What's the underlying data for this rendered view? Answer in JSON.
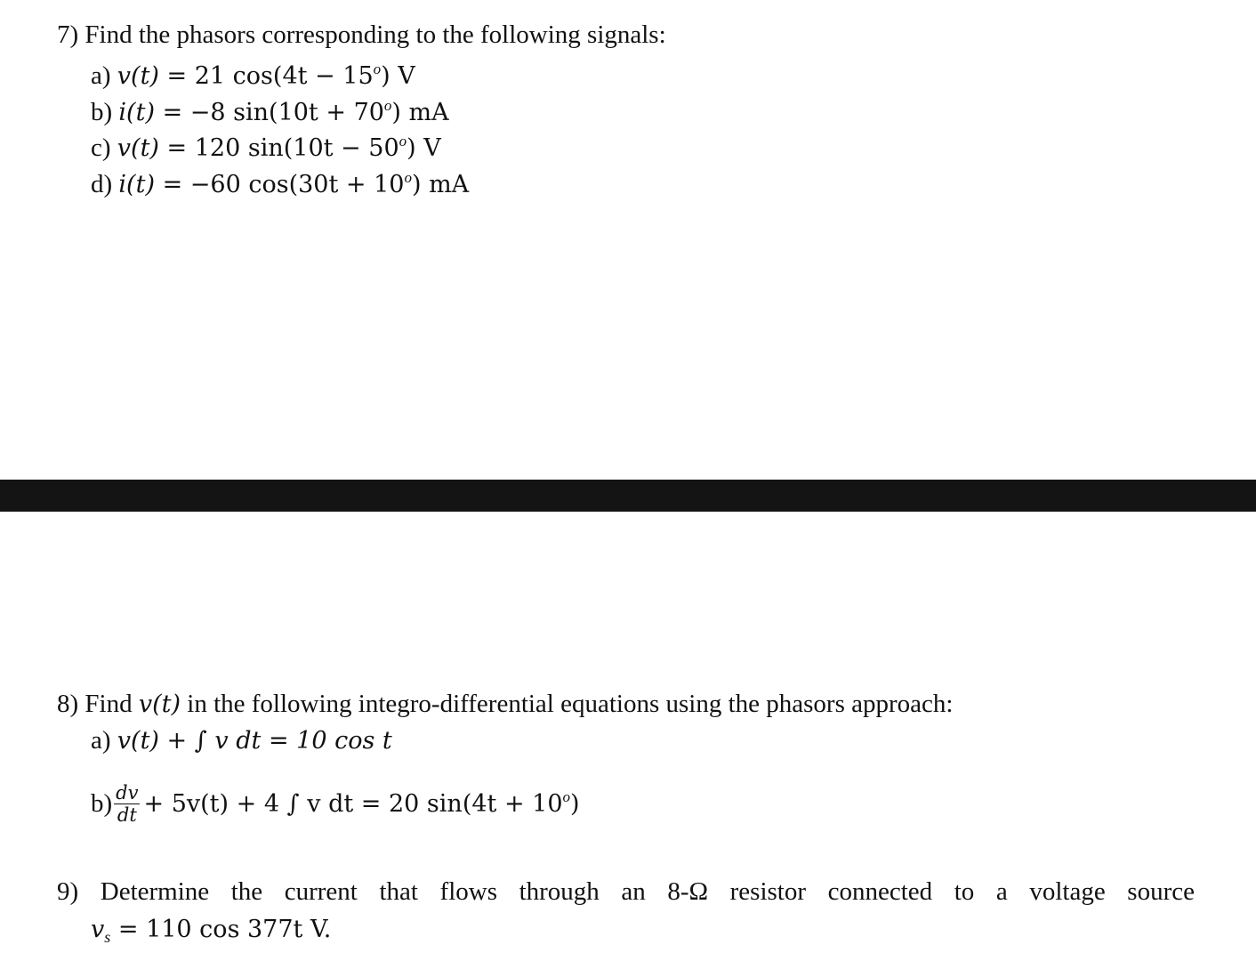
{
  "problem7": {
    "heading": "7) Find the phasors corresponding to the following signals:",
    "items": [
      {
        "label": "a)",
        "lhs": "v(t)",
        "eq": " = 21 cos(4t − 15",
        "deg": "o",
        "rest": ") V"
      },
      {
        "label": "b)",
        "lhs": "i(t)",
        "eq": " = −8 sin(10t + 70",
        "deg": "o",
        "rest": ") mA"
      },
      {
        "label": "c)",
        "lhs": "v(t)",
        "eq": " = 120 sin(10t − 50",
        "deg": "o",
        "rest": ") V"
      },
      {
        "label": "d)",
        "lhs": "i(t)",
        "eq": " = −60 cos(30t + 10",
        "deg": "o",
        "rest": ") mA"
      }
    ]
  },
  "problem8": {
    "heading_pre": "8) Find ",
    "heading_var": "v(t)",
    "heading_post": " in the following integro-differential equations using the phasors approach:",
    "a": {
      "label": "a)",
      "expr": "v(t) + ∫ v dt = 10 cos t"
    },
    "b": {
      "label": "b)",
      "frac_num": "dv",
      "frac_den": "dt",
      "expr": "+ 5v(t) + 4 ∫ v dt = 20 sin(4t + 10",
      "deg": "o",
      "rest": ")"
    }
  },
  "problem9": {
    "line1": "9) Determine the current that flows through an 8-Ω resistor connected to a voltage source",
    "var": "v",
    "var_sub": "s",
    "expr": " = 110 cos 377t V."
  }
}
